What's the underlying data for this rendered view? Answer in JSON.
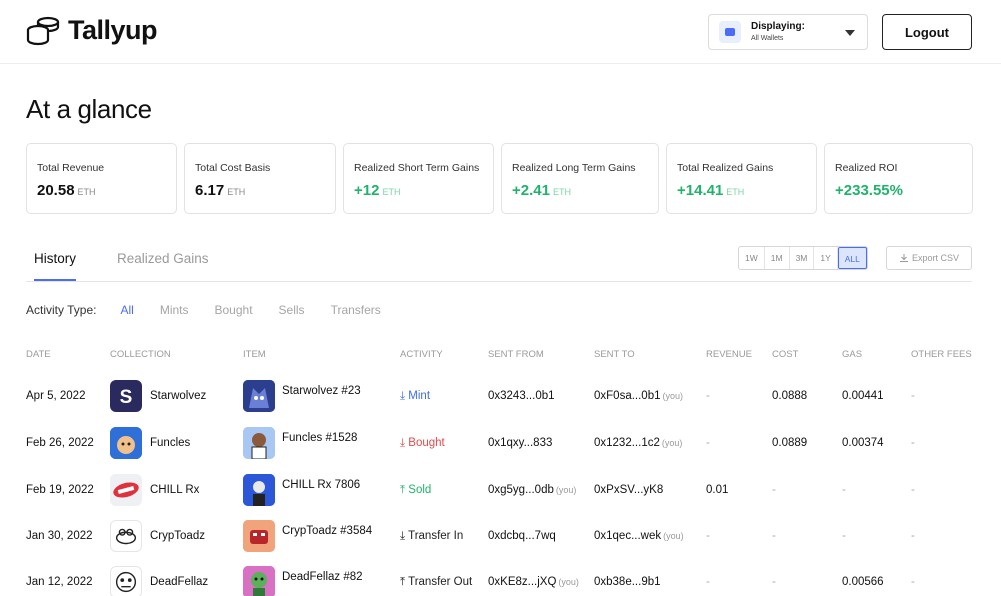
{
  "header": {
    "brand": "Tallyup",
    "wallet_label": "Displaying:",
    "wallet_value": "All Wallets",
    "logout_label": "Logout"
  },
  "page_title": "At a glance",
  "cards": [
    {
      "label": "Total Revenue",
      "value": "20.58",
      "unit": "ETH"
    },
    {
      "label": "Total Cost Basis",
      "value": "6.17",
      "unit": "ETH"
    },
    {
      "label": "Realized Short Term Gains",
      "value": "+12",
      "unit": "ETH"
    },
    {
      "label": "Realized Long Term Gains",
      "value": "+2.41",
      "unit": "ETH"
    },
    {
      "label": "Total Realized Gains",
      "value": "+14.41",
      "unit": "ETH"
    },
    {
      "label": "Realized ROI",
      "value": "+233.55%",
      "unit": ""
    }
  ],
  "tabs": [
    "History",
    "Realized Gains"
  ],
  "ranges": [
    "1W",
    "1M",
    "3M",
    "1Y",
    "ALL"
  ],
  "export_label": "Export CSV",
  "filter": {
    "label": "Activity Type:",
    "items": [
      "All",
      "Mints",
      "Bought",
      "Sells",
      "Transfers"
    ]
  },
  "columns": [
    "DATE",
    "COLLECTION",
    "ITEM",
    "ACTIVITY",
    "SENT FROM",
    "SENT TO",
    "REVENUE",
    "COST",
    "GAS",
    "OTHER FEES"
  ],
  "rows": [
    {
      "date": "Apr 5, 2022",
      "collection": "Starwolvez",
      "item": "Starwolvez #23",
      "activity": "Mint",
      "from": "0x3243...0b1",
      "from_you": "",
      "to": "0xF0sa...0b1",
      "to_you": "(you)",
      "revenue": "-",
      "cost": "0.0888",
      "gas": "0.00441",
      "fees": "-"
    },
    {
      "date": "Feb 26, 2022",
      "collection": "Funcles",
      "item": "Funcles #1528",
      "activity": "Bought",
      "from": "0x1qxy...833",
      "from_you": "",
      "to": "0x1232...1c2",
      "to_you": "(you)",
      "revenue": "-",
      "cost": "0.0889",
      "gas": "0.00374",
      "fees": "-"
    },
    {
      "date": "Feb 19, 2022",
      "collection": "CHILL Rx",
      "item": "CHILL Rx 7806",
      "activity": "Sold",
      "from": "0xg5yg...0db",
      "from_you": "(you)",
      "to": "0xPxSV...yK8",
      "to_you": "",
      "revenue": "0.01",
      "cost": "-",
      "gas": "-",
      "fees": "-"
    },
    {
      "date": "Jan 30, 2022",
      "collection": "CrypToadz",
      "item": "CrypToadz #3584",
      "activity": "Transfer In",
      "from": "0xdcbq...7wq",
      "from_you": "",
      "to": "0x1qec...wek",
      "to_you": "(you)",
      "revenue": "-",
      "cost": "-",
      "gas": "-",
      "fees": "-"
    },
    {
      "date": "Jan 12, 2022",
      "collection": "DeadFellaz",
      "item": "DeadFellaz #82",
      "activity": "Transfer Out",
      "from": "0xKE8z...jXQ",
      "from_you": "(you)",
      "to": "0xb38e...9b1",
      "to_you": "",
      "revenue": "-",
      "cost": "-",
      "gas": "0.00566",
      "fees": "-"
    }
  ],
  "colors": {
    "accent": "#4a6cf7",
    "gain": "#1fb36b",
    "bought": "#e14b4b"
  }
}
